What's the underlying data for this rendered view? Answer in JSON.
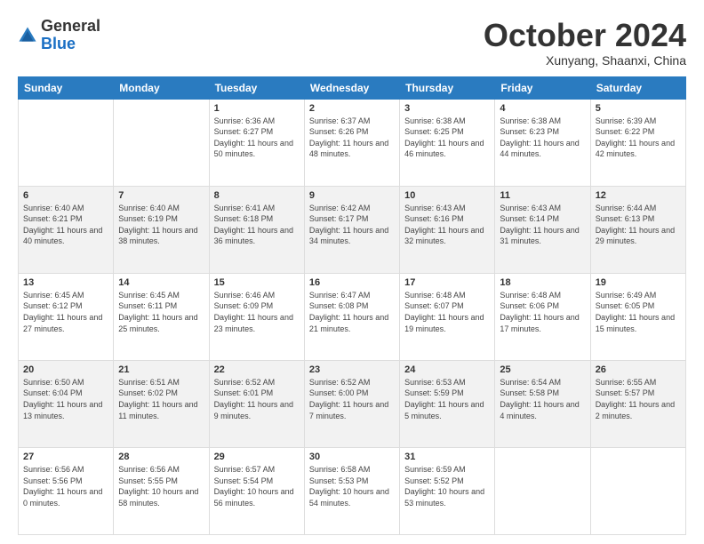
{
  "logo": {
    "general": "General",
    "blue": "Blue"
  },
  "header": {
    "month": "October 2024",
    "location": "Xunyang, Shaanxi, China"
  },
  "weekdays": [
    "Sunday",
    "Monday",
    "Tuesday",
    "Wednesday",
    "Thursday",
    "Friday",
    "Saturday"
  ],
  "weeks": [
    {
      "shaded": false,
      "days": [
        {
          "num": "",
          "info": ""
        },
        {
          "num": "",
          "info": ""
        },
        {
          "num": "1",
          "info": "Sunrise: 6:36 AM\nSunset: 6:27 PM\nDaylight: 11 hours and 50 minutes."
        },
        {
          "num": "2",
          "info": "Sunrise: 6:37 AM\nSunset: 6:26 PM\nDaylight: 11 hours and 48 minutes."
        },
        {
          "num": "3",
          "info": "Sunrise: 6:38 AM\nSunset: 6:25 PM\nDaylight: 11 hours and 46 minutes."
        },
        {
          "num": "4",
          "info": "Sunrise: 6:38 AM\nSunset: 6:23 PM\nDaylight: 11 hours and 44 minutes."
        },
        {
          "num": "5",
          "info": "Sunrise: 6:39 AM\nSunset: 6:22 PM\nDaylight: 11 hours and 42 minutes."
        }
      ]
    },
    {
      "shaded": true,
      "days": [
        {
          "num": "6",
          "info": "Sunrise: 6:40 AM\nSunset: 6:21 PM\nDaylight: 11 hours and 40 minutes."
        },
        {
          "num": "7",
          "info": "Sunrise: 6:40 AM\nSunset: 6:19 PM\nDaylight: 11 hours and 38 minutes."
        },
        {
          "num": "8",
          "info": "Sunrise: 6:41 AM\nSunset: 6:18 PM\nDaylight: 11 hours and 36 minutes."
        },
        {
          "num": "9",
          "info": "Sunrise: 6:42 AM\nSunset: 6:17 PM\nDaylight: 11 hours and 34 minutes."
        },
        {
          "num": "10",
          "info": "Sunrise: 6:43 AM\nSunset: 6:16 PM\nDaylight: 11 hours and 32 minutes."
        },
        {
          "num": "11",
          "info": "Sunrise: 6:43 AM\nSunset: 6:14 PM\nDaylight: 11 hours and 31 minutes."
        },
        {
          "num": "12",
          "info": "Sunrise: 6:44 AM\nSunset: 6:13 PM\nDaylight: 11 hours and 29 minutes."
        }
      ]
    },
    {
      "shaded": false,
      "days": [
        {
          "num": "13",
          "info": "Sunrise: 6:45 AM\nSunset: 6:12 PM\nDaylight: 11 hours and 27 minutes."
        },
        {
          "num": "14",
          "info": "Sunrise: 6:45 AM\nSunset: 6:11 PM\nDaylight: 11 hours and 25 minutes."
        },
        {
          "num": "15",
          "info": "Sunrise: 6:46 AM\nSunset: 6:09 PM\nDaylight: 11 hours and 23 minutes."
        },
        {
          "num": "16",
          "info": "Sunrise: 6:47 AM\nSunset: 6:08 PM\nDaylight: 11 hours and 21 minutes."
        },
        {
          "num": "17",
          "info": "Sunrise: 6:48 AM\nSunset: 6:07 PM\nDaylight: 11 hours and 19 minutes."
        },
        {
          "num": "18",
          "info": "Sunrise: 6:48 AM\nSunset: 6:06 PM\nDaylight: 11 hours and 17 minutes."
        },
        {
          "num": "19",
          "info": "Sunrise: 6:49 AM\nSunset: 6:05 PM\nDaylight: 11 hours and 15 minutes."
        }
      ]
    },
    {
      "shaded": true,
      "days": [
        {
          "num": "20",
          "info": "Sunrise: 6:50 AM\nSunset: 6:04 PM\nDaylight: 11 hours and 13 minutes."
        },
        {
          "num": "21",
          "info": "Sunrise: 6:51 AM\nSunset: 6:02 PM\nDaylight: 11 hours and 11 minutes."
        },
        {
          "num": "22",
          "info": "Sunrise: 6:52 AM\nSunset: 6:01 PM\nDaylight: 11 hours and 9 minutes."
        },
        {
          "num": "23",
          "info": "Sunrise: 6:52 AM\nSunset: 6:00 PM\nDaylight: 11 hours and 7 minutes."
        },
        {
          "num": "24",
          "info": "Sunrise: 6:53 AM\nSunset: 5:59 PM\nDaylight: 11 hours and 5 minutes."
        },
        {
          "num": "25",
          "info": "Sunrise: 6:54 AM\nSunset: 5:58 PM\nDaylight: 11 hours and 4 minutes."
        },
        {
          "num": "26",
          "info": "Sunrise: 6:55 AM\nSunset: 5:57 PM\nDaylight: 11 hours and 2 minutes."
        }
      ]
    },
    {
      "shaded": false,
      "days": [
        {
          "num": "27",
          "info": "Sunrise: 6:56 AM\nSunset: 5:56 PM\nDaylight: 11 hours and 0 minutes."
        },
        {
          "num": "28",
          "info": "Sunrise: 6:56 AM\nSunset: 5:55 PM\nDaylight: 10 hours and 58 minutes."
        },
        {
          "num": "29",
          "info": "Sunrise: 6:57 AM\nSunset: 5:54 PM\nDaylight: 10 hours and 56 minutes."
        },
        {
          "num": "30",
          "info": "Sunrise: 6:58 AM\nSunset: 5:53 PM\nDaylight: 10 hours and 54 minutes."
        },
        {
          "num": "31",
          "info": "Sunrise: 6:59 AM\nSunset: 5:52 PM\nDaylight: 10 hours and 53 minutes."
        },
        {
          "num": "",
          "info": ""
        },
        {
          "num": "",
          "info": ""
        }
      ]
    }
  ]
}
